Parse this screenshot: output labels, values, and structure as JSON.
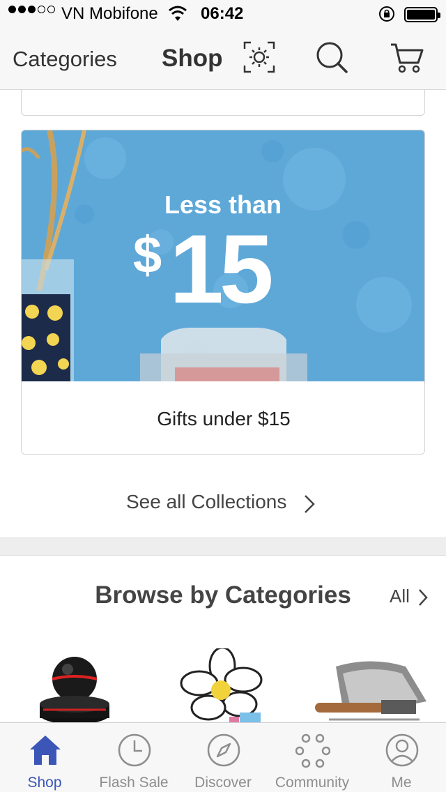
{
  "status_bar": {
    "carrier": "VN Mobifone",
    "time": "06:42"
  },
  "nav": {
    "categories": "Categories",
    "title": "Shop",
    "icons": [
      "scan-icon",
      "search-icon",
      "cart-icon"
    ]
  },
  "promo": {
    "banner_heading": "Less than",
    "banner_currency": "$",
    "banner_amount": "15",
    "caption": "Gifts under $15"
  },
  "see_all_collections": "See all Collections",
  "browse": {
    "title": "Browse by Categories",
    "all_label": "All"
  },
  "tabs": [
    {
      "label": "Shop",
      "icon": "home-icon",
      "active": true
    },
    {
      "label": "Flash Sale",
      "icon": "clock-icon",
      "active": false
    },
    {
      "label": "Discover",
      "icon": "compass-icon",
      "active": false
    },
    {
      "label": "Community",
      "icon": "community-icon",
      "active": false
    },
    {
      "label": "Me",
      "icon": "person-icon",
      "active": false
    }
  ],
  "colors": {
    "accent": "#3b56b7",
    "banner_bg": "#5ea8d8",
    "inactive": "#8e8e8e"
  }
}
